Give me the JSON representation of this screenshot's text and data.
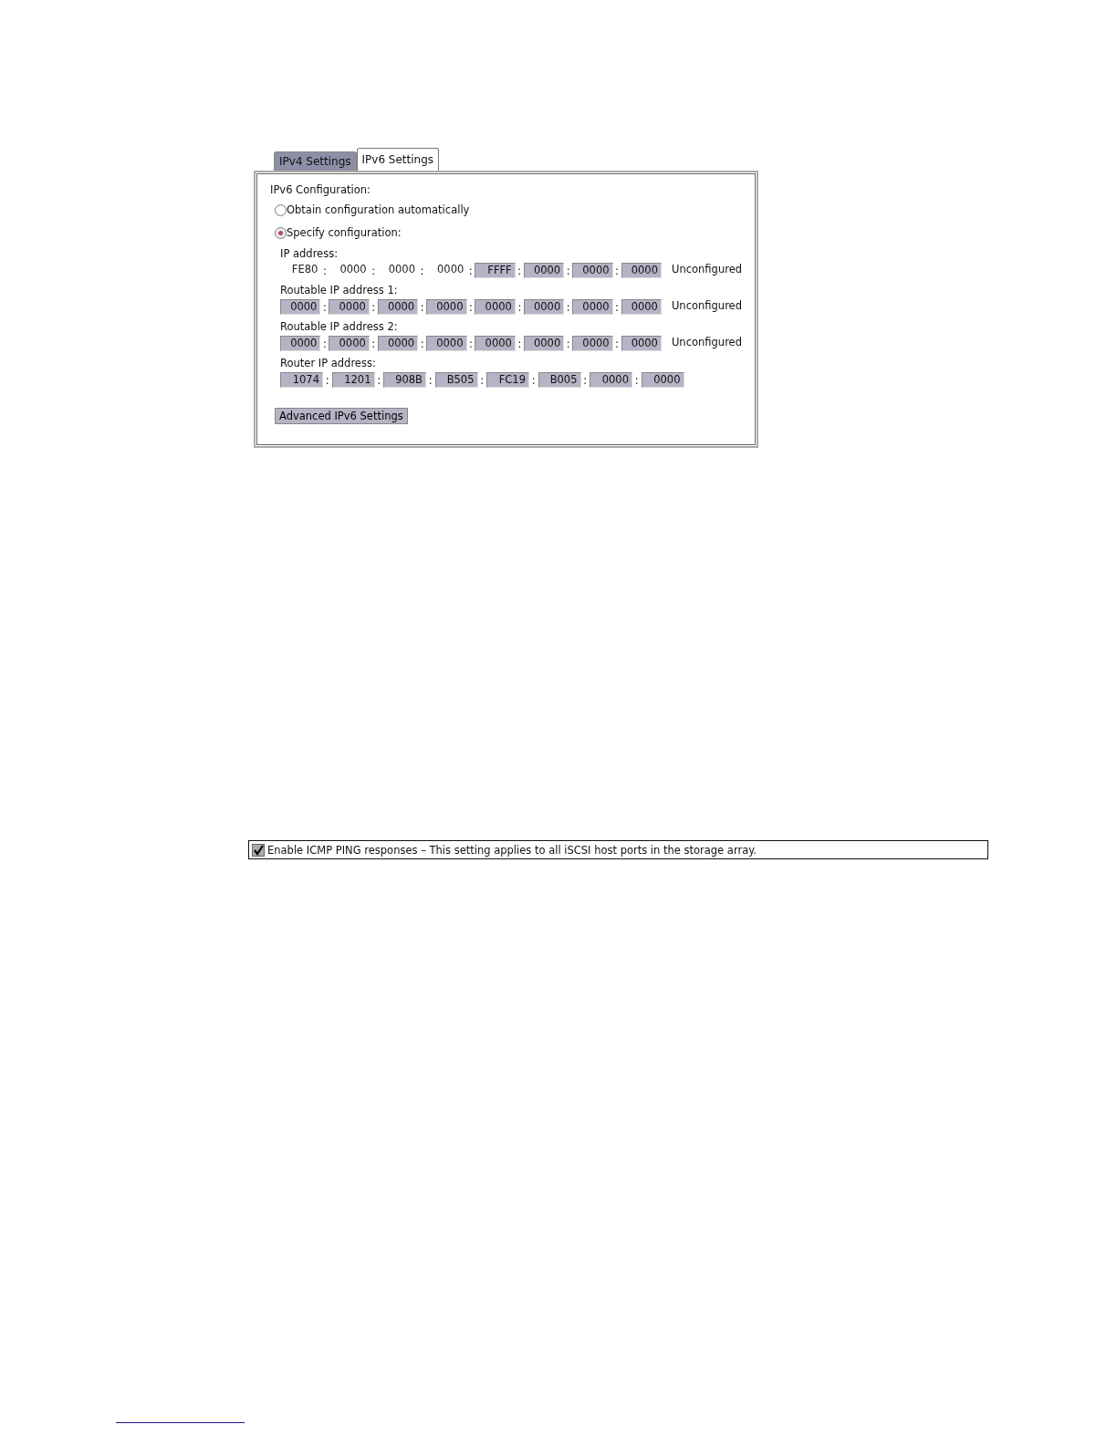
{
  "tabs": [
    {
      "label": "IPv4 Settings",
      "selected": false
    },
    {
      "label": "IPv6 Settings",
      "selected": true
    }
  ],
  "section_title": "IPv6 Configuration:",
  "radios": [
    {
      "label": "Obtain configuration automatically",
      "selected": false
    },
    {
      "label": "Specify configuration:",
      "selected": true
    }
  ],
  "addresses": [
    {
      "label": "IP address:",
      "status": "Unconfigured",
      "segments": [
        {
          "kind": "text",
          "value": "FE80"
        },
        {
          "kind": "text",
          "value": "0000"
        },
        {
          "kind": "text",
          "value": "0000"
        },
        {
          "kind": "text",
          "value": "0000"
        },
        {
          "kind": "field",
          "value": "FFFF"
        },
        {
          "kind": "field",
          "value": "0000"
        },
        {
          "kind": "field",
          "value": "0000"
        },
        {
          "kind": "field",
          "value": "0000"
        }
      ]
    },
    {
      "label": "Routable IP address 1:",
      "status": "Unconfigured",
      "segments": [
        {
          "kind": "field",
          "value": "0000"
        },
        {
          "kind": "field",
          "value": "0000"
        },
        {
          "kind": "field",
          "value": "0000"
        },
        {
          "kind": "field",
          "value": "0000"
        },
        {
          "kind": "field",
          "value": "0000"
        },
        {
          "kind": "field",
          "value": "0000"
        },
        {
          "kind": "field",
          "value": "0000"
        },
        {
          "kind": "field",
          "value": "0000"
        }
      ]
    },
    {
      "label": "Routable IP address 2:",
      "status": "Unconfigured",
      "segments": [
        {
          "kind": "field",
          "value": "0000"
        },
        {
          "kind": "field",
          "value": "0000"
        },
        {
          "kind": "field",
          "value": "0000"
        },
        {
          "kind": "field",
          "value": "0000"
        },
        {
          "kind": "field",
          "value": "0000"
        },
        {
          "kind": "field",
          "value": "0000"
        },
        {
          "kind": "field",
          "value": "0000"
        },
        {
          "kind": "field",
          "value": "0000"
        }
      ]
    },
    {
      "label": "Router IP address:",
      "segments": [
        {
          "kind": "field",
          "value": "1074"
        },
        {
          "kind": "field",
          "value": "1201"
        },
        {
          "kind": "field",
          "value": "908B"
        },
        {
          "kind": "field",
          "value": "B505"
        },
        {
          "kind": "field",
          "value": "FC19"
        },
        {
          "kind": "field",
          "value": "B005"
        },
        {
          "kind": "field",
          "value": "0000"
        },
        {
          "kind": "field",
          "value": "0000"
        }
      ]
    }
  ],
  "separator": ":",
  "advanced_button": "Advanced IPv6 Settings",
  "icmp": {
    "label": "Enable ICMP PING responses – This setting applies to all iSCSI host ports in the storage array.",
    "checked": true
  }
}
